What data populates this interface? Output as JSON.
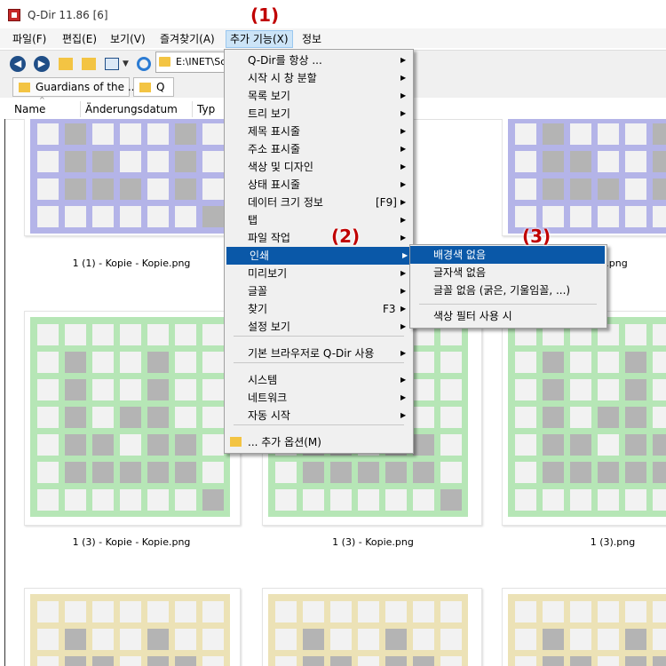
{
  "window": {
    "title": "Q-Dir 11.86 [6]"
  },
  "menubar": [
    {
      "label": "파일(F)"
    },
    {
      "label": "편집(E)"
    },
    {
      "label": "보기(V)"
    },
    {
      "label": "즐겨찾기(A)"
    },
    {
      "label": "추가 기능(X)"
    },
    {
      "label": "정보"
    }
  ],
  "toolbar": {
    "path": "E:\\INET\\Sc"
  },
  "tabs": [
    {
      "label": "Guardians of the ..."
    },
    {
      "label": "Q"
    }
  ],
  "columns": [
    {
      "label": "Name"
    },
    {
      "label": "Änderungsdatum"
    },
    {
      "label": "Typ"
    }
  ],
  "thumbnails": [
    {
      "label": "1 (1) - Kopie - Kopie.png",
      "color": "#b4b4e8"
    },
    {
      "label": ").png",
      "color": "#b4b4e8"
    },
    {
      "label": "1 (3) - Kopie - Kopie.png",
      "color": "#b6e6b6"
    },
    {
      "label": "1 (3) - Kopie.png",
      "color": "#b6e6b6"
    },
    {
      "label": "1 (3).png",
      "color": "#b6e6b6"
    },
    {
      "color": "#ece2b6"
    },
    {
      "color": "#ece2b6"
    },
    {
      "color": "#ece2b6"
    }
  ],
  "main_menu": {
    "items": [
      {
        "label": "Q-Dir를 항상 ...",
        "arrow": "▶"
      },
      {
        "label": "시작 시 창 분할",
        "arrow": "▶"
      },
      {
        "label": "목록 보기",
        "arrow": "▶"
      },
      {
        "label": "트리 보기",
        "arrow": "▶"
      },
      {
        "label": "제목 표시줄",
        "arrow": "▶"
      },
      {
        "label": "주소 표시줄",
        "arrow": "▶"
      },
      {
        "label": "색상 및 디자인",
        "arrow": "▶"
      },
      {
        "label": "상태 표시줄",
        "arrow": "▶"
      },
      {
        "label": "데이터 크기 정보",
        "shortcut": "[F9]",
        "arrow": "▶"
      },
      {
        "label": "탭",
        "arrow": "▶"
      },
      {
        "label": "파일 작업",
        "arrow": "▶"
      },
      {
        "label": "인쇄",
        "arrow": "▶"
      },
      {
        "label": "미리보기",
        "arrow": "▶"
      },
      {
        "label": "글꼴",
        "arrow": "▶"
      },
      {
        "label": "찾기",
        "shortcut": "F3",
        "arrow": "▶"
      },
      {
        "label": "설정 보기",
        "arrow": "▶"
      },
      {
        "label": "기본 브라우저로 Q-Dir 사용",
        "arrow": "▶"
      },
      {
        "label": "시스템",
        "arrow": "▶"
      },
      {
        "label": "네트워크",
        "arrow": "▶"
      },
      {
        "label": "자동 시작",
        "arrow": "▶"
      },
      {
        "label": "... 추가 옵션(M)"
      }
    ]
  },
  "print_submenu": {
    "items": [
      {
        "label": "배경색 없음"
      },
      {
        "label": "글자색 없음"
      },
      {
        "label": "글꼴 없음 (굵은, 기울임꼴, ...)"
      },
      {
        "label": "색상 필터 사용 시"
      }
    ]
  },
  "callouts": [
    "(1)",
    "(2)",
    "(3)"
  ],
  "colors": {
    "highlight": "#0a58a8",
    "callout": "#c00000",
    "menu_active": "#cce4f7"
  }
}
